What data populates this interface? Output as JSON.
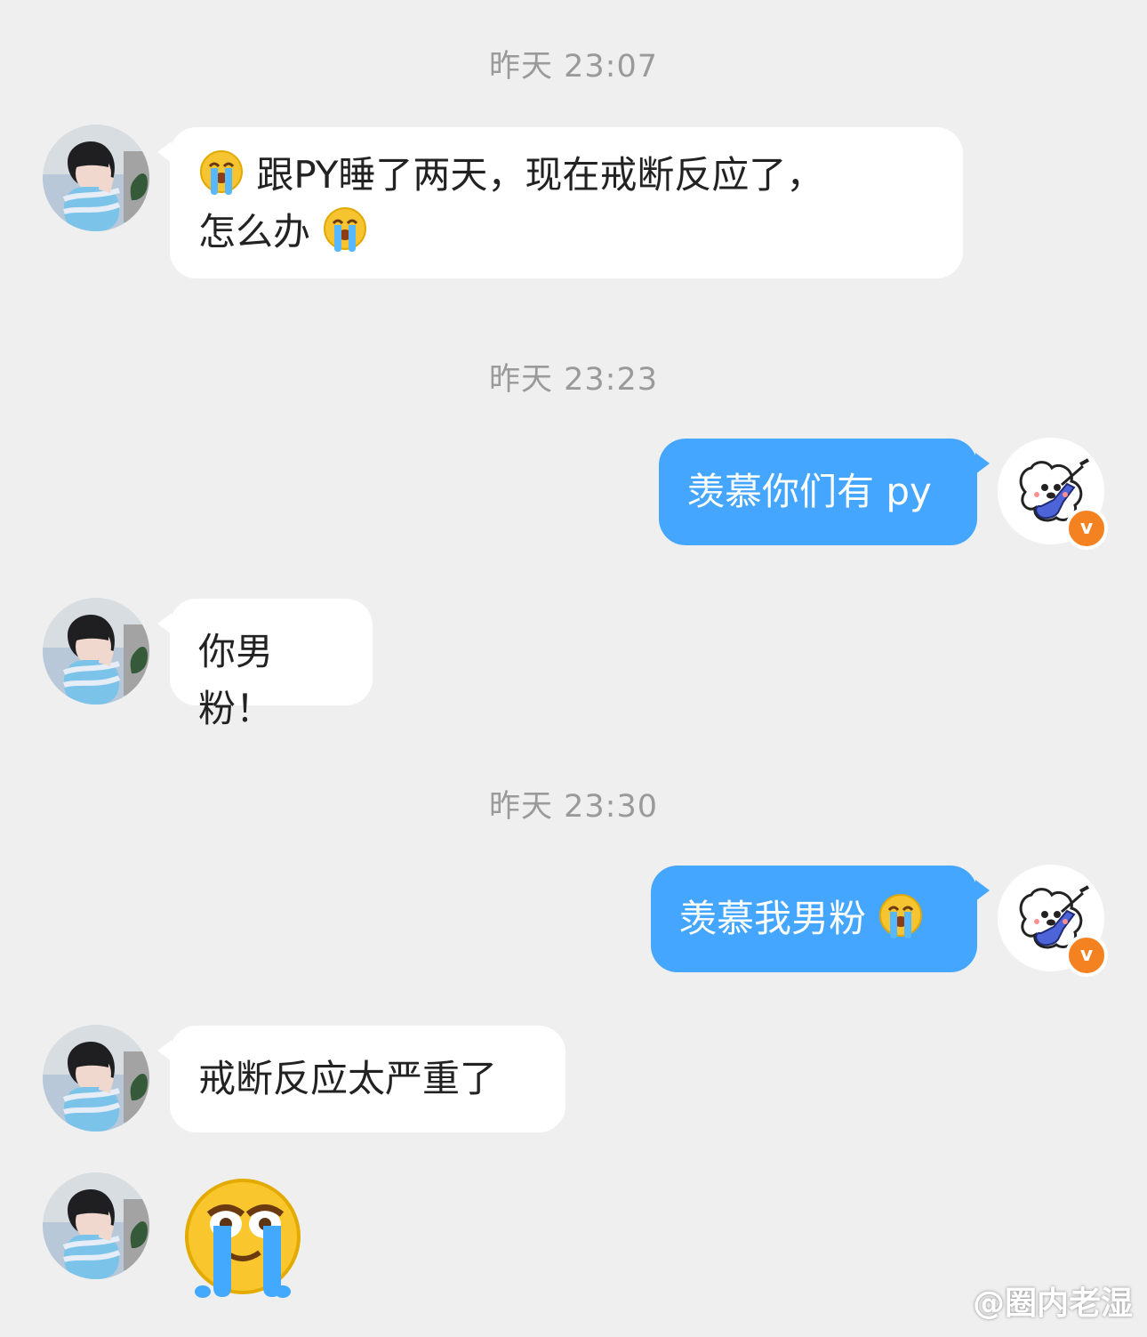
{
  "timestamps": {
    "t1": "昨天 23:07",
    "t2": "昨天 23:23",
    "t3": "昨天 23:30"
  },
  "messages": {
    "m1_part1": "跟PY睡了两天，现在戒断反应了，",
    "m1_part2": "怎么办",
    "m2": "羡慕你们有 py",
    "m3": "你男粉！",
    "m4": "羡慕我男粉",
    "m5": "戒断反应太严重了"
  },
  "icons": {
    "emoji_cry": "loudly-crying-face-icon",
    "emoji_big": "teary-face-icon"
  },
  "badges": {
    "verified_letter": "v"
  },
  "watermark": "@圈内老湿",
  "colors": {
    "background": "#efefef",
    "incoming_bubble": "#ffffff",
    "outgoing_bubble": "#44a6ff",
    "timestamp": "#9a9a9a",
    "verified_badge": "#f58220"
  }
}
